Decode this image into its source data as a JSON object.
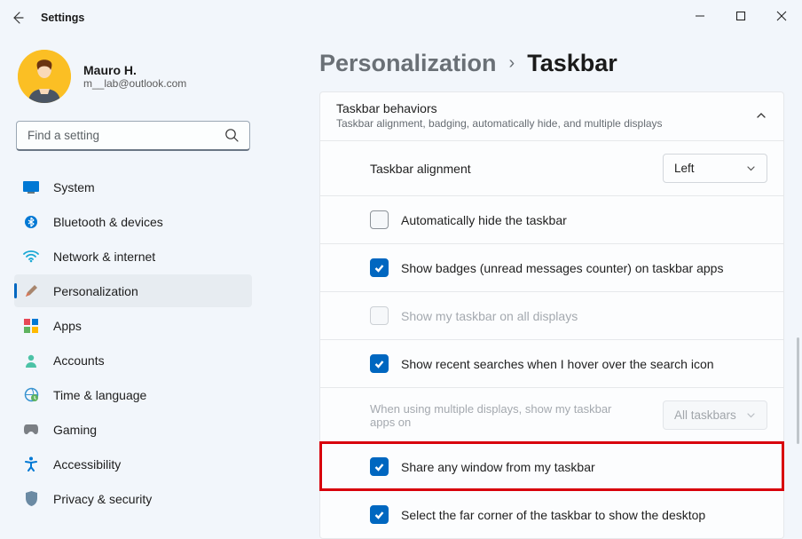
{
  "window": {
    "title": "Settings"
  },
  "profile": {
    "name": "Mauro H.",
    "email": "m__lab@outlook.com"
  },
  "search": {
    "placeholder": "Find a setting"
  },
  "sidebar": {
    "items": [
      {
        "label": "System"
      },
      {
        "label": "Bluetooth & devices"
      },
      {
        "label": "Network & internet"
      },
      {
        "label": "Personalization"
      },
      {
        "label": "Apps"
      },
      {
        "label": "Accounts"
      },
      {
        "label": "Time & language"
      },
      {
        "label": "Gaming"
      },
      {
        "label": "Accessibility"
      },
      {
        "label": "Privacy & security"
      }
    ]
  },
  "breadcrumb": {
    "parent": "Personalization",
    "current": "Taskbar"
  },
  "section": {
    "title": "Taskbar behaviors",
    "subtitle": "Taskbar alignment, badging, automatically hide, and multiple displays",
    "alignment_label": "Taskbar alignment",
    "alignment_value": "Left",
    "autohide": "Automatically hide the taskbar",
    "badges": "Show badges (unread messages counter) on taskbar apps",
    "all_displays": "Show my taskbar on all displays",
    "recent_search": "Show recent searches when I hover over the search icon",
    "multi_label": "When using multiple displays, show my taskbar apps on",
    "multi_value": "All taskbars",
    "share_window": "Share any window from my taskbar",
    "far_corner": "Select the far corner of the taskbar to show the desktop"
  }
}
